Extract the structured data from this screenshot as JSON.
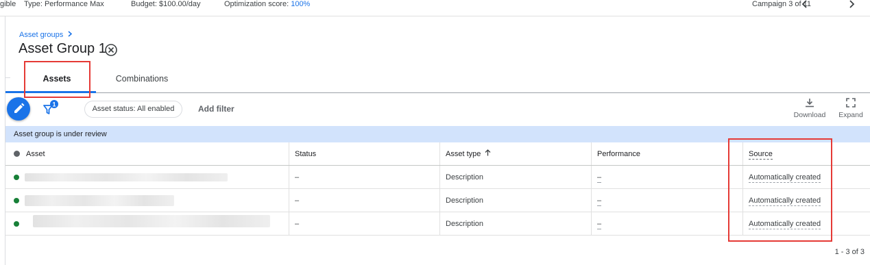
{
  "topbar": {
    "status_fragment": "gible",
    "type": "Type: Performance Max",
    "budget": "Budget: $100.00/day",
    "opt_label": "Optimization score: ",
    "opt_value": "100%",
    "campaign_position": "Campaign 3 of 11"
  },
  "breadcrumb": "Asset groups",
  "page_title": "Asset Group 1",
  "tabs": [
    {
      "label": "Assets",
      "active": true
    },
    {
      "label": "Combinations",
      "active": false
    }
  ],
  "toolbar": {
    "filter_badge": "1",
    "status_chip": "Asset status: All enabled",
    "add_filter": "Add filter",
    "download": "Download",
    "expand": "Expand"
  },
  "banner": "Asset group is under review",
  "table": {
    "columns": [
      "Asset",
      "Status",
      "Asset type",
      "Performance",
      "Source"
    ],
    "rows": [
      {
        "asset": "",
        "status": "–",
        "asset_type": "Description",
        "performance": "–",
        "source": "Automatically created"
      },
      {
        "asset": "",
        "status": "–",
        "asset_type": "Description",
        "performance": "–",
        "source": "Automatically created"
      },
      {
        "asset": "",
        "status": "–",
        "asset_type": "Description",
        "performance": "–",
        "source": "Automatically created"
      }
    ]
  },
  "pagination": "1 - 3 of 3",
  "colors": {
    "accent": "#1a73e8",
    "banner": "#d2e3fc",
    "enabled_dot": "#188038",
    "highlight_box": "#e53935"
  },
  "icons": [
    "chevron-right-icon",
    "close-circle-icon",
    "pencil-icon",
    "filter-icon",
    "download-icon",
    "expand-icon",
    "chevron-left-icon",
    "sort-up-icon"
  ]
}
